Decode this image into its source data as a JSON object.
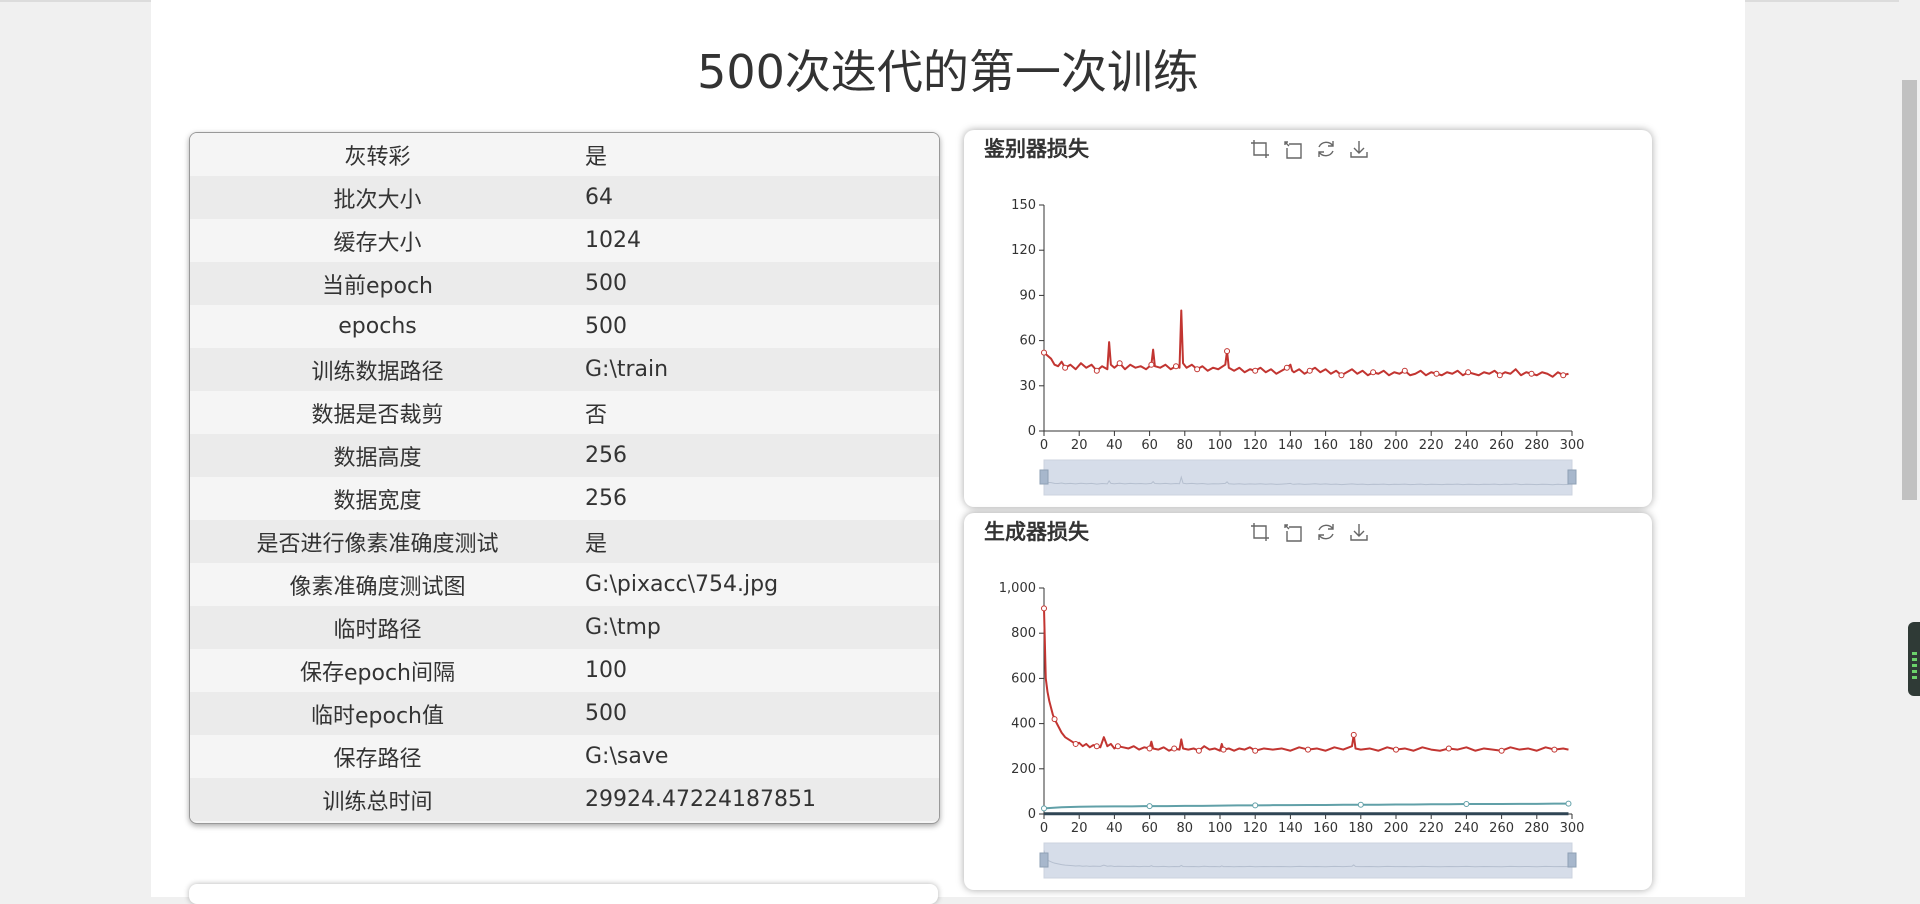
{
  "page": {
    "title": "500次迭代的第一次训练"
  },
  "params": [
    {
      "key": "灰转彩",
      "value": "是"
    },
    {
      "key": "批次大小",
      "value": "64"
    },
    {
      "key": "缓存大小",
      "value": "1024"
    },
    {
      "key": "当前epoch",
      "value": "500"
    },
    {
      "key": "epochs",
      "value": "500"
    },
    {
      "key": "训练数据路径",
      "value": "G:\\train"
    },
    {
      "key": "数据是否裁剪",
      "value": "否"
    },
    {
      "key": "数据高度",
      "value": "256"
    },
    {
      "key": "数据宽度",
      "value": "256"
    },
    {
      "key": "是否进行像素准确度测试",
      "value": "是"
    },
    {
      "key": "像素准确度测试图",
      "value": "G:\\pixacc\\754.jpg"
    },
    {
      "key": "临时路径",
      "value": "G:\\tmp"
    },
    {
      "key": "保存epoch间隔",
      "value": "100"
    },
    {
      "key": "临时epoch值",
      "value": "500"
    },
    {
      "key": "保存路径",
      "value": "G:\\save"
    },
    {
      "key": "训练总时间",
      "value": "29924.47224187851"
    }
  ],
  "toolbox": [
    "zoom-icon",
    "zoom-reset-icon",
    "restore-icon",
    "save-image-icon"
  ],
  "colors": {
    "series_red": "#c23531",
    "series_teal": "#61a0a8",
    "series_dark": "#2f4554",
    "zoom_fill": "#d6dde9"
  },
  "chart_data": [
    {
      "type": "line",
      "title": "鉴别器损失",
      "xlabel": "",
      "ylabel": "",
      "xlim": [
        0,
        300
      ],
      "ylim": [
        0,
        150
      ],
      "yticks": [
        0,
        30,
        60,
        90,
        120,
        150
      ],
      "yticklabels": [
        "0",
        "30",
        "60",
        "90",
        "120",
        "150"
      ],
      "xticks": [
        0,
        20,
        40,
        60,
        80,
        100,
        120,
        140,
        160,
        180,
        200,
        220,
        240,
        260,
        280,
        300
      ],
      "series": [
        {
          "color": "#c23531",
          "x": [
            0,
            2,
            4,
            6,
            8,
            10,
            12,
            15,
            18,
            21,
            24,
            27,
            30,
            33,
            36,
            37,
            38,
            40,
            43,
            46,
            49,
            52,
            55,
            58,
            61,
            62,
            63,
            66,
            69,
            72,
            75,
            77,
            78,
            79,
            81,
            84,
            87,
            90,
            93,
            96,
            99,
            103,
            104,
            105,
            108,
            111,
            114,
            117,
            120,
            123,
            126,
            129,
            132,
            135,
            138,
            140,
            141,
            142,
            145,
            148,
            151,
            154,
            157,
            160,
            163,
            166,
            169,
            172,
            175,
            178,
            181,
            184,
            187,
            190,
            193,
            196,
            199,
            202,
            205,
            208,
            211,
            214,
            217,
            220,
            223,
            226,
            229,
            232,
            235,
            238,
            241,
            244,
            247,
            250,
            253,
            256,
            259,
            262,
            265,
            268,
            271,
            274,
            277,
            280,
            283,
            286,
            289,
            292,
            295,
            298
          ],
          "y": [
            52,
            50,
            48,
            44,
            43,
            46,
            42,
            44,
            41,
            45,
            42,
            44,
            40,
            43,
            41,
            59,
            44,
            42,
            45,
            41,
            44,
            42,
            43,
            41,
            44,
            54,
            43,
            42,
            44,
            41,
            43,
            42,
            80,
            45,
            42,
            44,
            41,
            43,
            40,
            42,
            41,
            44,
            53,
            42,
            40,
            42,
            39,
            41,
            40,
            42,
            39,
            41,
            38,
            40,
            42,
            44,
            40,
            39,
            41,
            38,
            40,
            42,
            39,
            41,
            38,
            40,
            37,
            39,
            41,
            38,
            40,
            37,
            39,
            38,
            40,
            37,
            39,
            38,
            40,
            37,
            38,
            40,
            37,
            39,
            38,
            37,
            39,
            38,
            40,
            37,
            39,
            38,
            37,
            39,
            38,
            40,
            37,
            39,
            38,
            41,
            37,
            39,
            38,
            37,
            39,
            38,
            36,
            39,
            37,
            38
          ]
        }
      ]
    },
    {
      "type": "line",
      "title": "生成器损失",
      "xlabel": "",
      "ylabel": "",
      "xlim": [
        0,
        300
      ],
      "ylim": [
        0,
        1000
      ],
      "yticks": [
        0,
        200,
        400,
        600,
        800,
        1000
      ],
      "yticklabels": [
        "0",
        "200",
        "400",
        "600",
        "800",
        "1,000"
      ],
      "xticks": [
        0,
        20,
        40,
        60,
        80,
        100,
        120,
        140,
        160,
        180,
        200,
        220,
        240,
        260,
        280,
        300
      ],
      "series": [
        {
          "color": "#c23531",
          "x": [
            0,
            1,
            2,
            3,
            4,
            5,
            6,
            8,
            10,
            12,
            14,
            16,
            18,
            20,
            22,
            24,
            26,
            28,
            30,
            32,
            34,
            36,
            38,
            40,
            42,
            45,
            48,
            51,
            54,
            57,
            60,
            61,
            62,
            65,
            68,
            71,
            74,
            77,
            78,
            79,
            82,
            85,
            88,
            91,
            94,
            97,
            100,
            101,
            102,
            105,
            108,
            111,
            114,
            117,
            120,
            125,
            130,
            135,
            140,
            145,
            150,
            155,
            160,
            165,
            170,
            175,
            176,
            177,
            180,
            185,
            190,
            195,
            200,
            205,
            210,
            215,
            220,
            225,
            230,
            235,
            240,
            245,
            250,
            255,
            260,
            265,
            270,
            275,
            280,
            285,
            290,
            295,
            298
          ],
          "y": [
            910,
            600,
            540,
            500,
            470,
            440,
            420,
            390,
            360,
            340,
            330,
            320,
            310,
            315,
            300,
            310,
            295,
            305,
            300,
            295,
            340,
            300,
            310,
            290,
            300,
            295,
            290,
            300,
            285,
            295,
            290,
            320,
            290,
            285,
            295,
            280,
            290,
            285,
            330,
            290,
            285,
            290,
            280,
            300,
            285,
            290,
            280,
            310,
            285,
            290,
            280,
            290,
            285,
            295,
            280,
            290,
            285,
            290,
            280,
            295,
            285,
            290,
            280,
            295,
            285,
            300,
            350,
            290,
            285,
            290,
            280,
            295,
            285,
            290,
            280,
            295,
            285,
            280,
            290,
            285,
            295,
            280,
            290,
            285,
            280,
            295,
            285,
            290,
            280,
            295,
            285,
            290,
            285
          ]
        },
        {
          "color": "#61a0a8",
          "x": [
            0,
            10,
            20,
            30,
            40,
            50,
            60,
            70,
            80,
            90,
            100,
            110,
            120,
            130,
            140,
            150,
            160,
            170,
            180,
            190,
            200,
            210,
            220,
            230,
            240,
            250,
            260,
            270,
            280,
            290,
            298
          ],
          "y": [
            25,
            30,
            32,
            33,
            34,
            34,
            35,
            35,
            36,
            36,
            37,
            38,
            38,
            39,
            39,
            40,
            40,
            41,
            41,
            41,
            42,
            42,
            43,
            43,
            44,
            44,
            44,
            45,
            45,
            46,
            46
          ]
        },
        {
          "color": "#2f4554",
          "x": [
            0,
            298
          ],
          "y": [
            1,
            1
          ]
        }
      ]
    }
  ]
}
